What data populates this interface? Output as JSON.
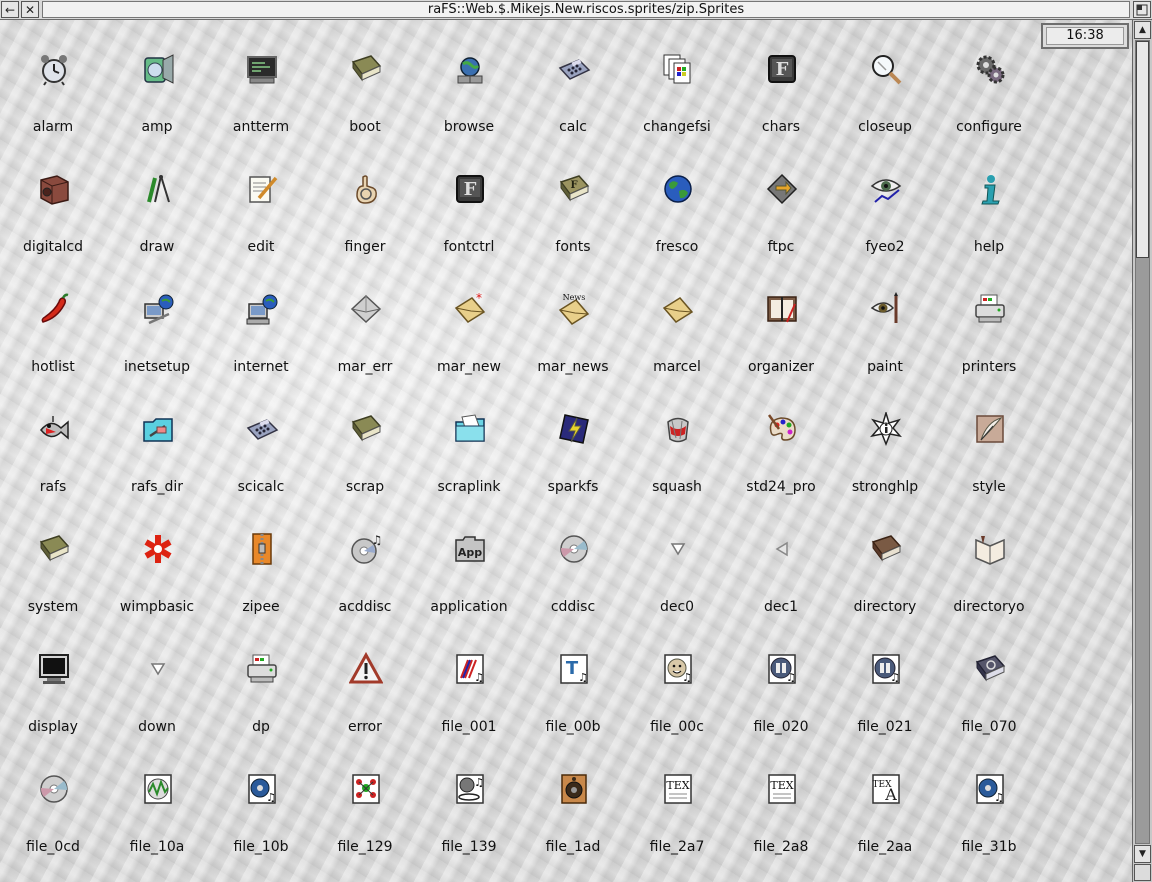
{
  "window": {
    "title": "raFS::Web.$.Mikejs.New.riscos.sprites/zip.Sprites",
    "back_glyph": "←",
    "close_glyph": "✕",
    "toggle_glyph": ""
  },
  "clock": {
    "time": "16:38"
  },
  "scroll": {
    "fraction_visible": 0.27
  },
  "sprites": [
    {
      "label": "alarm",
      "icon": "alarm-clock-icon"
    },
    {
      "label": "amp",
      "icon": "speaker-disc-icon"
    },
    {
      "label": "antterm",
      "icon": "terminal-icon"
    },
    {
      "label": "boot",
      "icon": "book-icon"
    },
    {
      "label": "browse",
      "icon": "globe-network-icon"
    },
    {
      "label": "calc",
      "icon": "calculator-icon"
    },
    {
      "label": "changefsi",
      "icon": "files-stack-icon"
    },
    {
      "label": "chars",
      "icon": "font-key-icon"
    },
    {
      "label": "closeup",
      "icon": "magnifier-icon"
    },
    {
      "label": "configure",
      "icon": "gears-icon"
    },
    {
      "label": "digitalcd",
      "icon": "speaker-box-icon"
    },
    {
      "label": "draw",
      "icon": "compass-pencil-icon"
    },
    {
      "label": "edit",
      "icon": "notepad-pencil-icon"
    },
    {
      "label": "finger",
      "icon": "pointing-hand-icon"
    },
    {
      "label": "fontctrl",
      "icon": "font-key-icon"
    },
    {
      "label": "fonts",
      "icon": "font-book-icon"
    },
    {
      "label": "fresco",
      "icon": "earth-icon"
    },
    {
      "label": "ftpc",
      "icon": "diamond-arrows-icon"
    },
    {
      "label": "fyeo2",
      "icon": "eye-chart-icon"
    },
    {
      "label": "help",
      "icon": "info-i-icon"
    },
    {
      "label": "hotlist",
      "icon": "chili-icon"
    },
    {
      "label": "inetsetup",
      "icon": "computer-globe-tools-icon"
    },
    {
      "label": "internet",
      "icon": "computer-globe-icon"
    },
    {
      "label": "mar_err",
      "icon": "envelope-grey-icon"
    },
    {
      "label": "mar_new",
      "icon": "envelope-star-icon"
    },
    {
      "label": "mar_news",
      "icon": "envelope-news-icon"
    },
    {
      "label": "marcel",
      "icon": "envelope-icon"
    },
    {
      "label": "organizer",
      "icon": "organizer-icon"
    },
    {
      "label": "paint",
      "icon": "eye-brush-icon"
    },
    {
      "label": "printers",
      "icon": "printer-icon"
    },
    {
      "label": "rafs",
      "icon": "fish-icon"
    },
    {
      "label": "rafs_dir",
      "icon": "folder-cyan-icon"
    },
    {
      "label": "scicalc",
      "icon": "calculator-icon"
    },
    {
      "label": "scrap",
      "icon": "book-icon"
    },
    {
      "label": "scraplink",
      "icon": "folder-open-icon"
    },
    {
      "label": "sparkfs",
      "icon": "spark-lightning-icon"
    },
    {
      "label": "squash",
      "icon": "crushed-can-icon"
    },
    {
      "label": "std24_pro",
      "icon": "palette-brush-icon"
    },
    {
      "label": "stronghlp",
      "icon": "star-info-icon"
    },
    {
      "label": "style",
      "icon": "quill-icon"
    },
    {
      "label": "system",
      "icon": "book-icon"
    },
    {
      "label": "wimpbasic",
      "icon": "red-asterisk-icon"
    },
    {
      "label": "zipee",
      "icon": "zipper-icon"
    },
    {
      "label": "acddisc",
      "icon": "cd-music-icon"
    },
    {
      "label": "application",
      "icon": "app-box-icon"
    },
    {
      "label": "cddisc",
      "icon": "cd-icon"
    },
    {
      "label": "dec0",
      "icon": "triangle-down-icon"
    },
    {
      "label": "dec1",
      "icon": "triangle-left-icon"
    },
    {
      "label": "directory",
      "icon": "brown-book-icon"
    },
    {
      "label": "directoryo",
      "icon": "open-book-icon"
    },
    {
      "label": "display",
      "icon": "monitor-icon"
    },
    {
      "label": "down",
      "icon": "triangle-down-icon"
    },
    {
      "label": "dp",
      "icon": "printer-icon"
    },
    {
      "label": "error",
      "icon": "warning-triangle-icon"
    },
    {
      "label": "file_001",
      "icon": "music-file-stripes-icon"
    },
    {
      "label": "file_00b",
      "icon": "music-file-t-icon"
    },
    {
      "label": "file_00c",
      "icon": "music-file-face-icon"
    },
    {
      "label": "file_020",
      "icon": "music-file-tiles-icon"
    },
    {
      "label": "file_021",
      "icon": "music-file-tiles-icon"
    },
    {
      "label": "file_070",
      "icon": "music-file-dark-icon"
    },
    {
      "label": "file_0cd",
      "icon": "cd-icon"
    },
    {
      "label": "file_10a",
      "icon": "waveform-file-icon"
    },
    {
      "label": "file_10b",
      "icon": "disc-music-file-icon"
    },
    {
      "label": "file_129",
      "icon": "molecule-file-icon"
    },
    {
      "label": "file_139",
      "icon": "ball-music-file-icon"
    },
    {
      "label": "file_1ad",
      "icon": "speaker-file-icon"
    },
    {
      "label": "file_2a7",
      "icon": "tex-file-icon"
    },
    {
      "label": "file_2a8",
      "icon": "tex-file-icon"
    },
    {
      "label": "file_2aa",
      "icon": "tex-a-file-icon"
    },
    {
      "label": "file_31b",
      "icon": "disc-music-file-icon"
    }
  ]
}
